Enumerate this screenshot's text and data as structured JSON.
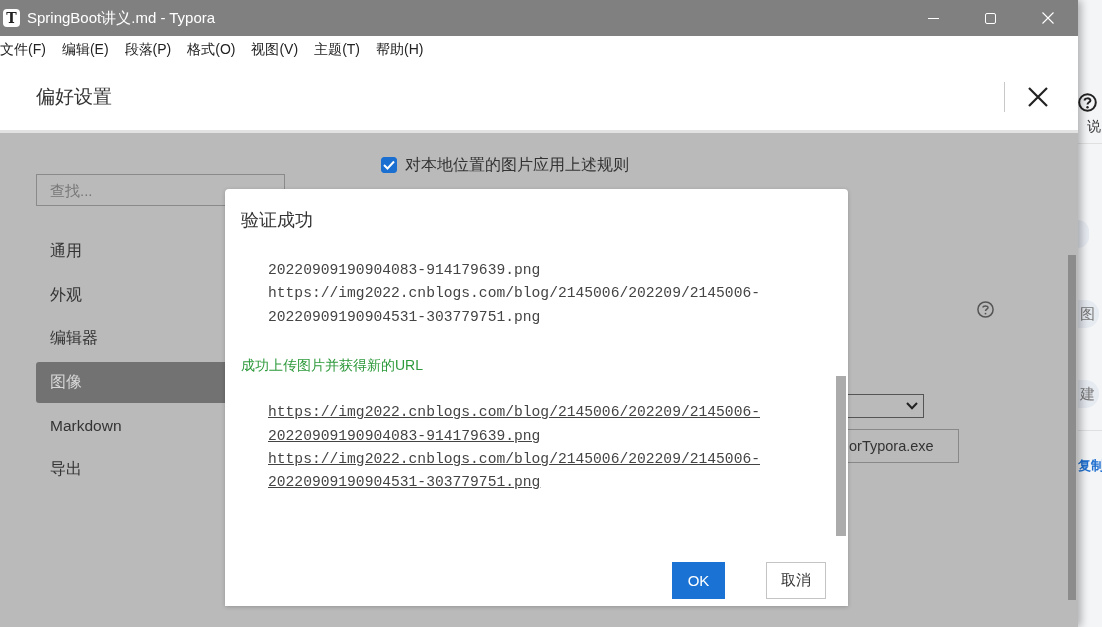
{
  "window": {
    "app_icon": "T",
    "title": "SpringBoot讲义.md - Typora"
  },
  "menu_bar": [
    "文件(F)",
    "编辑(E)",
    "段落(P)",
    "格式(O)",
    "视图(V)",
    "主题(T)",
    "帮助(H)"
  ],
  "preferences": {
    "title": "偏好设置",
    "search": {
      "placeholder": "查找..."
    },
    "sidebar_items": [
      {
        "label": "通用",
        "selected": false
      },
      {
        "label": "外观",
        "selected": false
      },
      {
        "label": "编辑器",
        "selected": false
      },
      {
        "label": "图像",
        "selected": true
      },
      {
        "label": "Markdown",
        "selected": false
      },
      {
        "label": "导出",
        "selected": false
      }
    ],
    "apply_rule": {
      "label": "对本地位置的图片应用上述规则",
      "checked": true
    },
    "uploader_path": {
      "value": "orTypora.exe"
    }
  },
  "dialog": {
    "title": "验证成功",
    "log_lines": [
      "20220909190904083-914179639.png",
      "https://img2022.cnblogs.com/blog/2145006/202209/2145006-20220909190904531-303779751.png"
    ],
    "message": "成功上传图片并获得新的URL",
    "urls": [
      "https://img2022.cnblogs.com/blog/2145006/202209/2145006-20220909190904083-914179639.png",
      "https://img2022.cnblogs.com/blog/2145006/202209/2145006-20220909190904531-303779751.png"
    ],
    "buttons": [
      {
        "label": "OK",
        "kind": "primary"
      },
      {
        "label": "取消",
        "kind": "secondary"
      }
    ]
  },
  "background_app": {
    "label": "说",
    "chips": [
      {
        "kind": "blank"
      },
      {
        "kind": "text",
        "label": "图"
      },
      {
        "kind": "text",
        "label": "建"
      }
    ],
    "link": "复制"
  }
}
